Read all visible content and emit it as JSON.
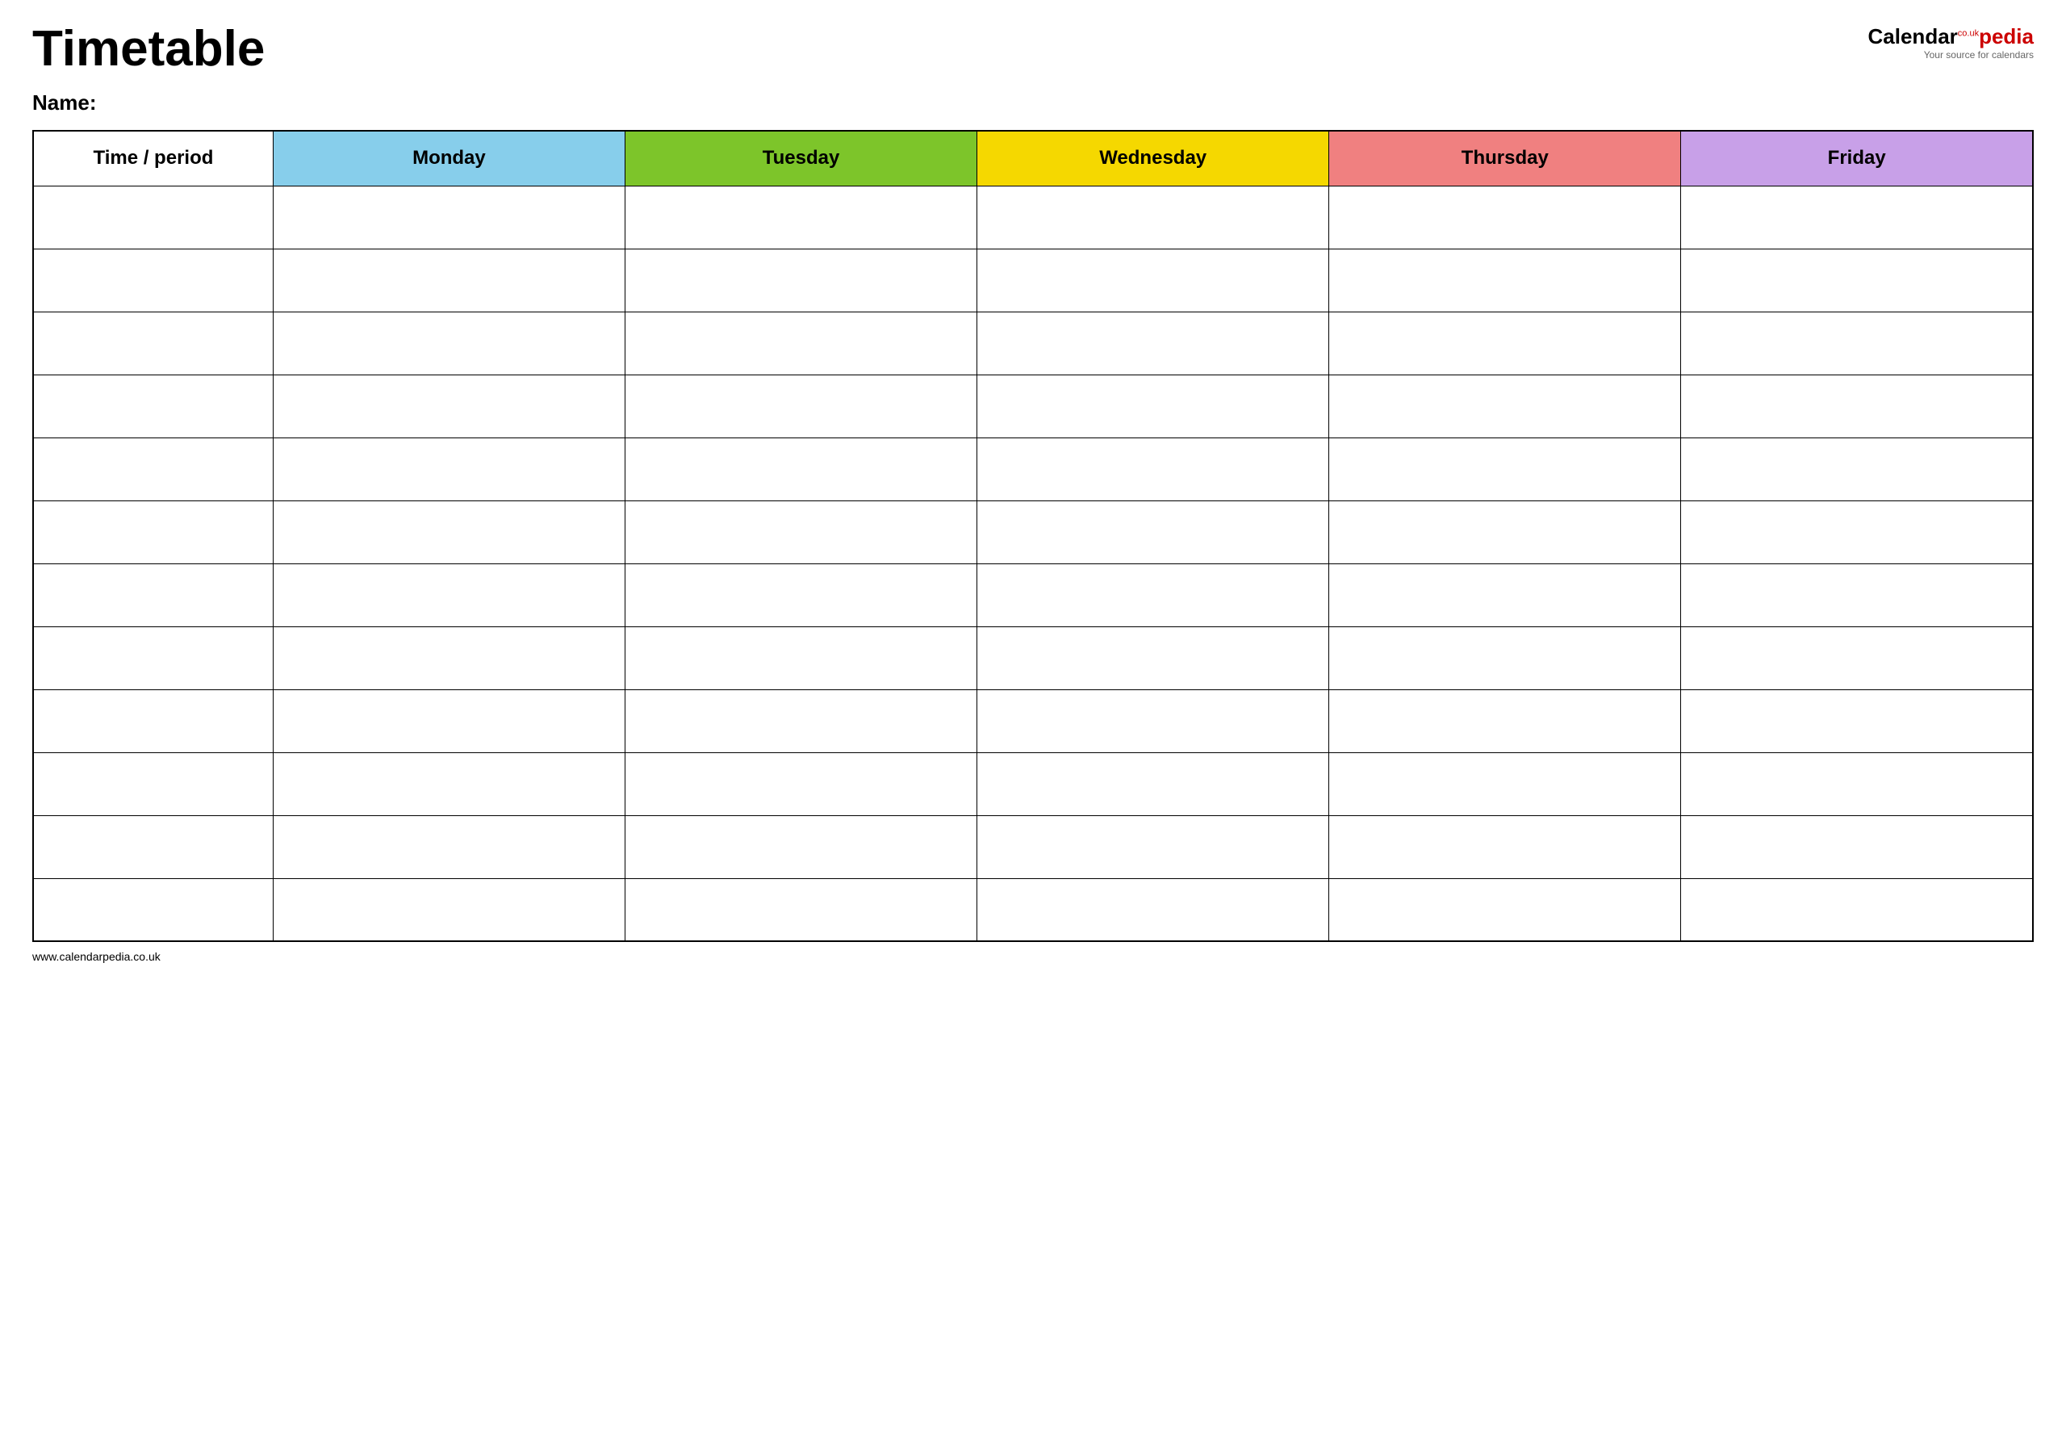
{
  "header": {
    "title": "Timetable",
    "logo": {
      "calendar_part": "Calendar",
      "co_uk": "co.uk",
      "pedia_part": "pedia",
      "tagline": "Your source for calendars"
    }
  },
  "name_label": "Name:",
  "table": {
    "columns": [
      {
        "id": "time",
        "label": "Time / period",
        "color": "#ffffff",
        "class": "time-header"
      },
      {
        "id": "monday",
        "label": "Monday",
        "color": "#87ceeb",
        "class": "monday-header"
      },
      {
        "id": "tuesday",
        "label": "Tuesday",
        "color": "#7dc52a",
        "class": "tuesday-header"
      },
      {
        "id": "wednesday",
        "label": "Wednesday",
        "color": "#f5d800",
        "class": "wednesday-header"
      },
      {
        "id": "thursday",
        "label": "Thursday",
        "color": "#f08080",
        "class": "thursday-header"
      },
      {
        "id": "friday",
        "label": "Friday",
        "color": "#c8a0e8",
        "class": "friday-header"
      }
    ],
    "row_count": 12
  },
  "footer": {
    "url": "www.calendarpedia.co.uk"
  }
}
